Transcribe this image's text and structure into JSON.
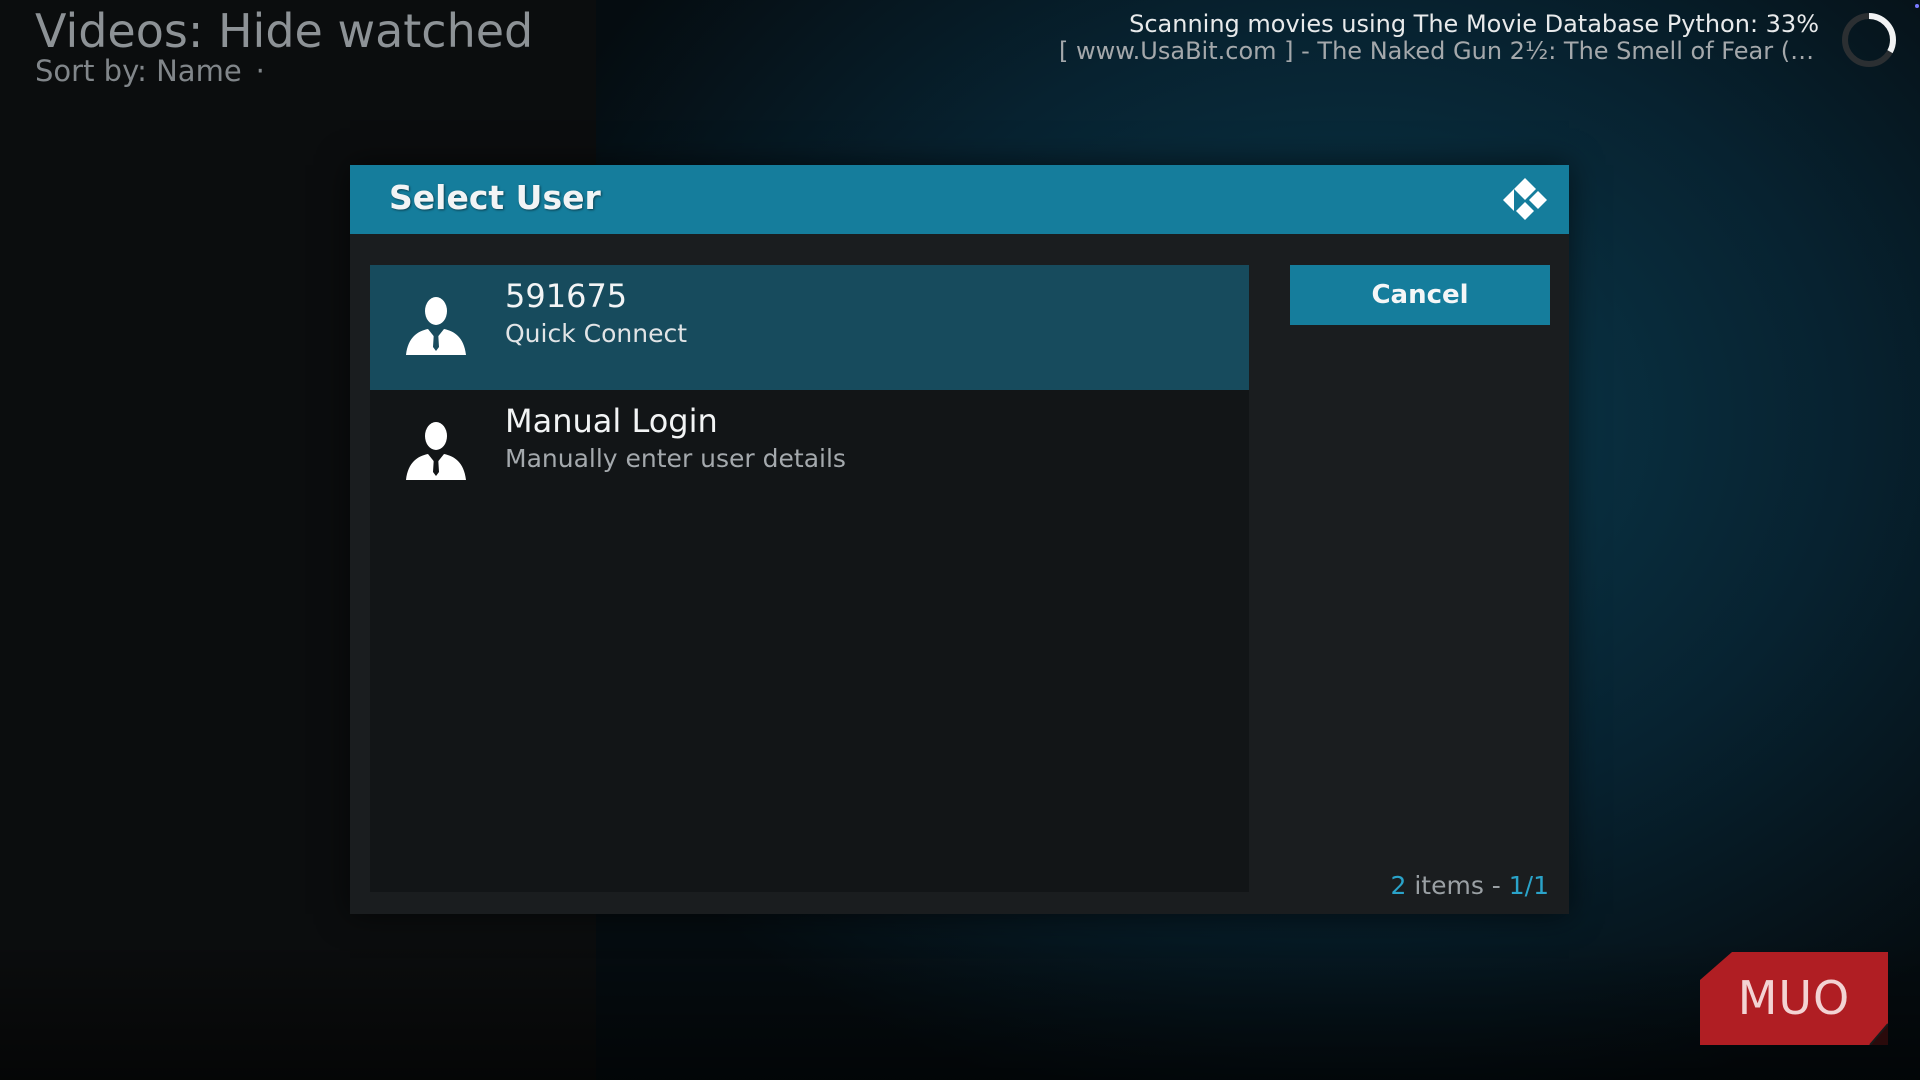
{
  "header": {
    "title": "Videos: Hide watched",
    "sort_label": "Sort by: Name",
    "sort_separator": "·"
  },
  "scan_status": {
    "line1": "Scanning movies using The Movie Database Python: 33%",
    "line2": "[ www.UsaBit.com ] - The Naked Gun 2½: The Smell of Fear (19...",
    "progress_percent": 33
  },
  "dialog": {
    "title": "Select User",
    "items": [
      {
        "title": "591675",
        "subtitle": "Quick Connect",
        "icon": "user-icon",
        "focused": true
      },
      {
        "title": "Manual Login",
        "subtitle": "Manually enter user details",
        "icon": "user-icon",
        "focused": false
      }
    ],
    "cancel_label": "Cancel",
    "count": {
      "number": "2",
      "items_label": " items - ",
      "page": "1/1"
    }
  },
  "watermark": {
    "text": "MUO"
  },
  "colors": {
    "accent": "#157d9c",
    "focused_item": "#174b5d",
    "dialog_bg": "#1a1d1f",
    "list_bg": "#121517",
    "count_accent": "#2aa3c9",
    "watermark_red": "#b01e23"
  }
}
